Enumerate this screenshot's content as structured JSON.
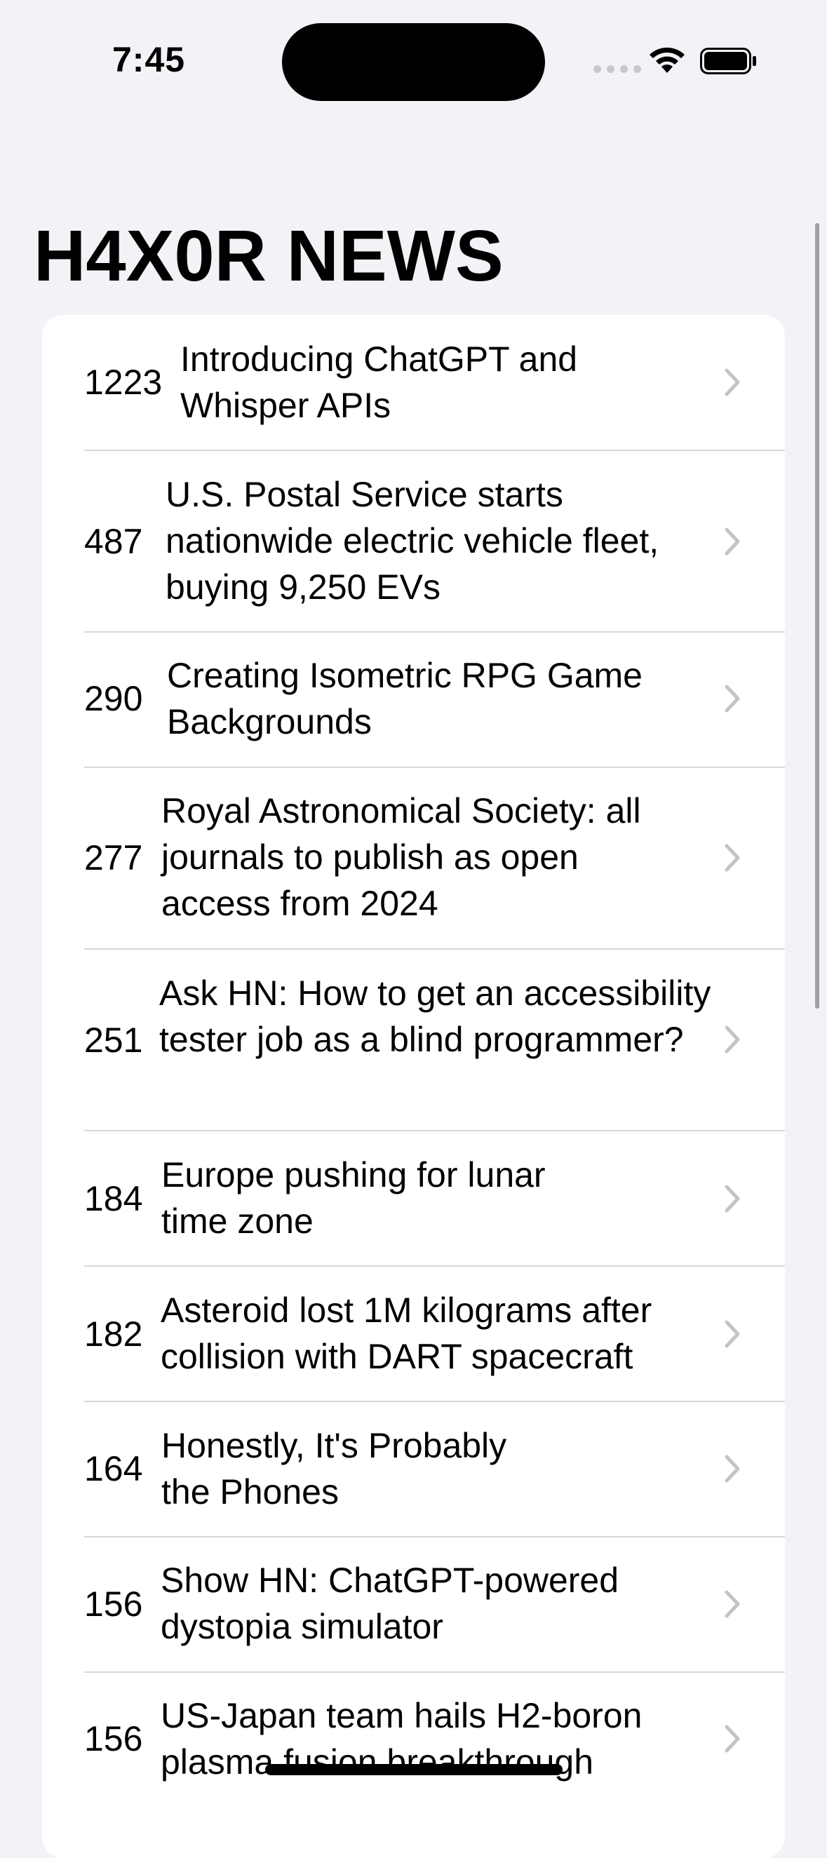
{
  "status_bar": {
    "time": "7:45"
  },
  "header": {
    "title": "H4X0R NEWS"
  },
  "stories": [
    {
      "points": "1223",
      "title": "Introducing ChatGPT and Whisper APIs"
    },
    {
      "points": "487",
      "title": "U.S. Postal Service starts nationwide electric vehicle fleet, buying 9,250 EVs"
    },
    {
      "points": "290",
      "title": "Creating Isometric RPG Game Backgrounds"
    },
    {
      "points": "277",
      "title": "Royal Astronomical Society: all journals to publish as open access from 2024"
    },
    {
      "points": "251",
      "title": "Ask HN: How to get an accessibility tester job as a blind programmer?"
    },
    {
      "points": "184",
      "title": "Europe pushing for lunar time zone"
    },
    {
      "points": "182",
      "title": "Asteroid lost 1M kilograms after collision with DART spacecraft"
    },
    {
      "points": "164",
      "title": "Honestly, It's Probably the Phones"
    },
    {
      "points": "156",
      "title": "Show HN: ChatGPT-powered dystopia simulator"
    },
    {
      "points": "156",
      "title": "US-Japan team hails H2-boron plasma fusion breakthrough"
    }
  ],
  "icons": {
    "row_disclosure": "chevron-right-icon",
    "wifi": "wifi-icon",
    "battery": "battery-icon"
  },
  "colors": {
    "background": "#f2f2f7",
    "card": "#ffffff",
    "chevron": "#c4c4c7",
    "separator": "#d8d8dc"
  }
}
